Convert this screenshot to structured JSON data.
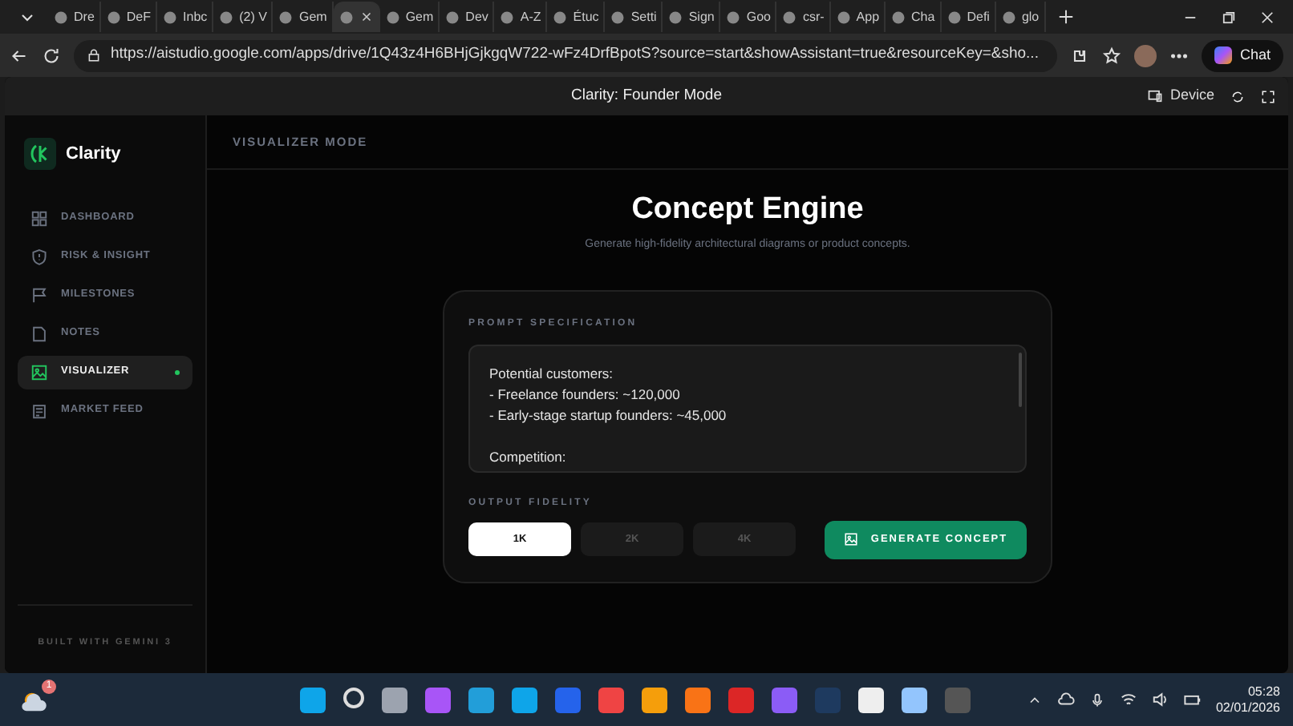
{
  "browser": {
    "tabs": [
      {
        "label": "Dre",
        "selected": false
      },
      {
        "label": "DeF",
        "selected": false
      },
      {
        "label": "Inbc",
        "selected": false
      },
      {
        "label": "(2) V",
        "selected": false
      },
      {
        "label": "Gem",
        "selected": false
      },
      {
        "selected": true
      },
      {
        "label": "Gem",
        "selected": false
      },
      {
        "label": "Dev",
        "selected": false
      },
      {
        "label": "A-Z",
        "selected": false
      },
      {
        "label": "Étuc",
        "selected": false
      },
      {
        "label": "Setti",
        "selected": false
      },
      {
        "label": "Sign",
        "selected": false
      },
      {
        "label": "Goo",
        "selected": false
      },
      {
        "label": "csr-",
        "selected": false
      },
      {
        "label": "App",
        "selected": false
      },
      {
        "label": "Cha",
        "selected": false
      },
      {
        "label": "Defi",
        "selected": false
      },
      {
        "label": "glo",
        "selected": false
      }
    ],
    "url": "https://aistudio.google.com/apps/drive/1Q43z4H6BHjGjkgqW722-wFz4DrfBpotS?source=start&showAssistant=true&resourceKey=&sho...",
    "chat_button": "Chat"
  },
  "app_bar": {
    "title": "Clarity: Founder Mode",
    "device_button": "Device"
  },
  "sidebar": {
    "brand": "Clarity",
    "items": [
      {
        "label": "DASHBOARD",
        "selected": false
      },
      {
        "label": "RISK & INSIGHT",
        "selected": false
      },
      {
        "label": "MILESTONES",
        "selected": false
      },
      {
        "label": "NOTES",
        "selected": false
      },
      {
        "label": "VISUALIZER",
        "selected": true
      },
      {
        "label": "MARKET FEED",
        "selected": false
      }
    ],
    "footer": "BUILT WITH GEMINI 3"
  },
  "header": {
    "title": "VISUALIZER MODE"
  },
  "main": {
    "title": "Concept Engine",
    "subtitle": "Generate high-fidelity architectural diagrams or product concepts.",
    "prompt_label": "PROMPT SPECIFICATION",
    "prompt_value": "Potential customers:\n- Freelance founders: ~120,000\n- Early-stage startup founders: ~45,000\n\nCompetition:",
    "fidelity_label": "OUTPUT FIDELITY",
    "fidelity": [
      {
        "label": "1K",
        "selected": true
      },
      {
        "label": "2K",
        "selected": false
      },
      {
        "label": "4K",
        "selected": false
      }
    ],
    "generate_button": "GENERATE CONCEPT"
  },
  "taskbar": {
    "weather_badge": "1",
    "time": "05:28",
    "date": "02/01/2026"
  }
}
